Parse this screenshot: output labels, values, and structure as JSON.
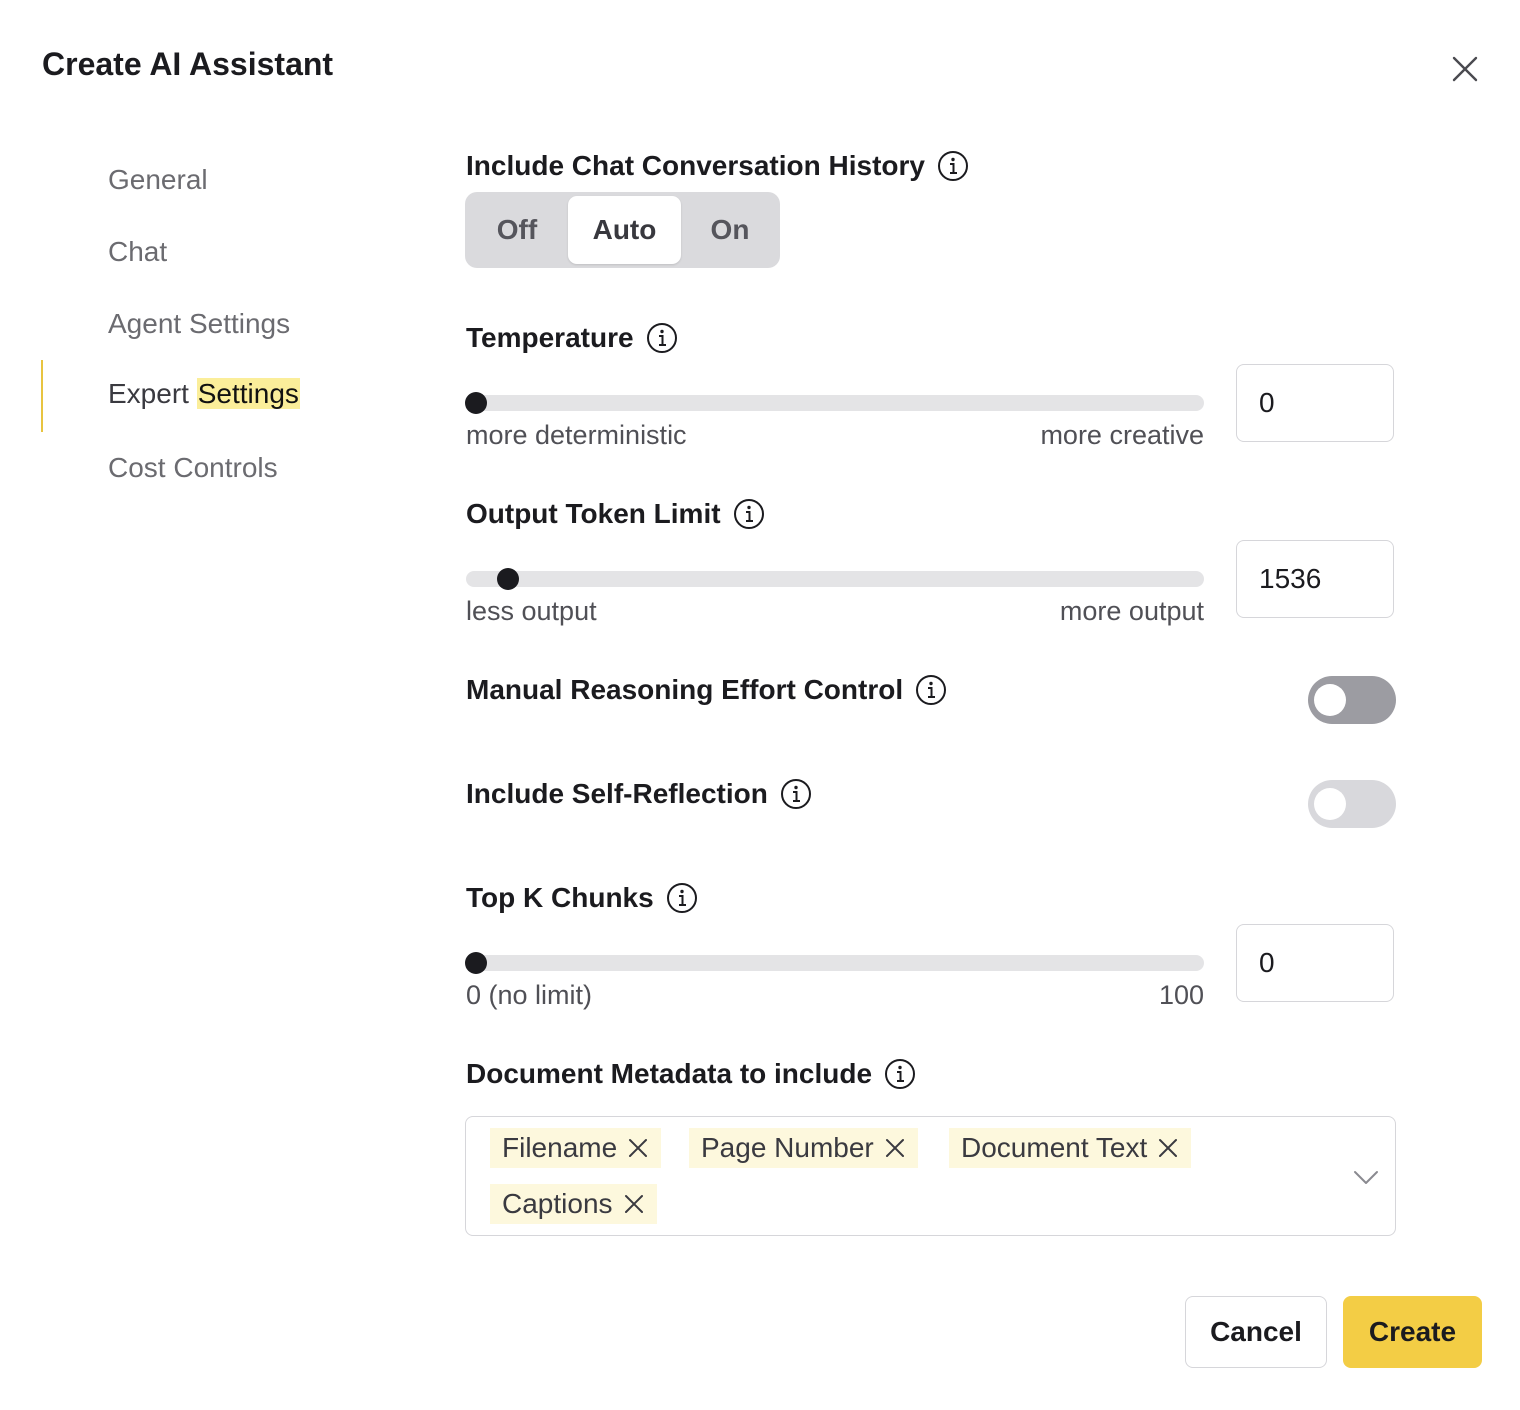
{
  "dialog": {
    "title": "Create AI Assistant"
  },
  "nav": {
    "general": "General",
    "chat": "Chat",
    "agent_settings": "Agent Settings",
    "expert_prefix": "Expert",
    "expert_highlight": "Settings",
    "cost_controls": "Cost Controls",
    "active": "Expert Settings"
  },
  "chat_history": {
    "label": "Include Chat Conversation History",
    "options": [
      "Off",
      "Auto",
      "On"
    ],
    "selected": "Auto"
  },
  "temperature": {
    "label": "Temperature",
    "value": "0",
    "min_hint": "more deterministic",
    "max_hint": "more creative",
    "slider_fraction": 0
  },
  "output_token_limit": {
    "label": "Output Token Limit",
    "value": "1536",
    "min_hint": "less output",
    "max_hint": "more output",
    "slider_fraction": 0.045
  },
  "manual_reasoning": {
    "label": "Manual Reasoning Effort Control",
    "enabled": false
  },
  "self_reflection": {
    "label": "Include Self-Reflection",
    "enabled": false
  },
  "top_k": {
    "label": "Top K Chunks",
    "value": "0",
    "min_hint": "0 (no limit)",
    "max_hint": "100",
    "slider_fraction": 0
  },
  "metadata": {
    "label": "Document Metadata to include",
    "tags": [
      "Filename",
      "Page Number",
      "Document Text",
      "Captions"
    ]
  },
  "footer": {
    "cancel": "Cancel",
    "create": "Create"
  },
  "colors": {
    "accent": "#f3cd45",
    "highlight": "#fbee9a",
    "tag_bg": "#fdf8dd"
  }
}
